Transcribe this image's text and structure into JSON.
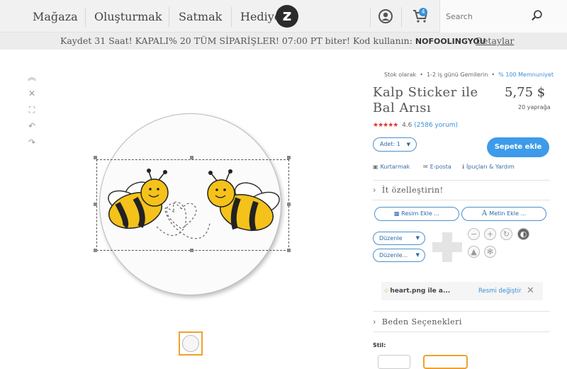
{
  "nav": {
    "items": [
      "Mağaza",
      "Oluşturmak",
      "Satmak",
      "Hediye"
    ],
    "cart_count": "4",
    "search_placeholder": "Search"
  },
  "promo": {
    "text": "Kaydet 31 Saat! KAPALI% 20 TÜM SİPARİŞLER! 07:00 PT biter! Kod kullanın: ",
    "code": "NOFOOLINGYOU",
    "link": "Detaylar"
  },
  "tools": [
    "collapse-icon",
    "close-icon",
    "fit-icon",
    "undo-icon",
    "redo-icon"
  ],
  "product": {
    "meta_stock": "Stok olarak",
    "meta_ship": "1-2 iş günü Gemilerin",
    "meta_satisfaction": "% 100 Memnuniyet",
    "title": "Kalp Sticker ile Bal Arısı",
    "price": "5,75 $",
    "per": "20 yaprağa",
    "stars": "★★★★★",
    "rating": "4.6",
    "reviews": "(2586 yorum)",
    "qty_label": "Adet: 1",
    "add_to_cart": "Sepete ekle",
    "save": "Kurtarmak",
    "email": "E-posta",
    "tips": "İpuçları & Yardım"
  },
  "customize": {
    "title": "İt özelleştirin!",
    "add_image": "Resim Ekle ...",
    "add_text": "Metin Ekle ...",
    "arrange": "Düzenle",
    "edit": "Düzenle...",
    "layer_file": "heart.png ile a...",
    "change_image": "Resmi değiştir"
  },
  "size_section": {
    "title": "Beden Seçenekleri",
    "style_label": "Stil:"
  }
}
